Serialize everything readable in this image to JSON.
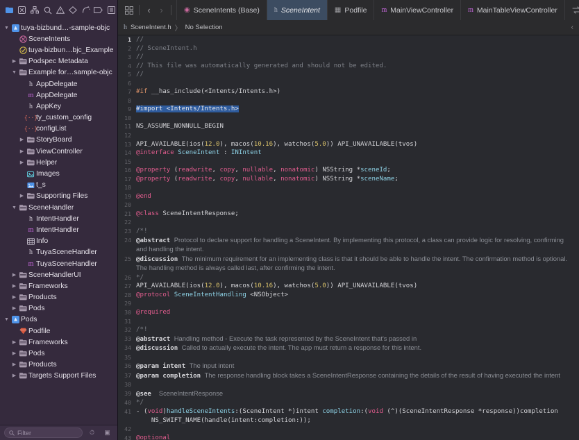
{
  "window": {
    "toolbar_icons": [
      "folder-icon",
      "issue-icon",
      "hierarchy-icon",
      "search-icon",
      "warning-icon",
      "diamond-icon",
      "debug-icon",
      "breakpoint-icon",
      "report-icon"
    ]
  },
  "navigator": {
    "filter_placeholder": "Filter",
    "items": [
      {
        "depth": 0,
        "twisty": "open",
        "icon": "proj",
        "label": "tuya-bizbund…-sample-objc"
      },
      {
        "depth": 1,
        "twisty": "",
        "icon": "scene",
        "label": "SceneIntents"
      },
      {
        "depth": 1,
        "twisty": "",
        "icon": "test",
        "label": "tuya-bizbun…bjc_Example"
      },
      {
        "depth": 1,
        "twisty": "closed",
        "icon": "folder",
        "label": "Podspec Metadata"
      },
      {
        "depth": 1,
        "twisty": "open",
        "icon": "folder",
        "label": "Example for…sample-objc"
      },
      {
        "depth": 2,
        "twisty": "",
        "icon": "h",
        "label": "AppDelegate"
      },
      {
        "depth": 2,
        "twisty": "",
        "icon": "m",
        "label": "AppDelegate"
      },
      {
        "depth": 2,
        "twisty": "",
        "icon": "h",
        "label": "AppKey"
      },
      {
        "depth": 2,
        "twisty": "",
        "icon": "plist",
        "label": "ty_custom_config"
      },
      {
        "depth": 2,
        "twisty": "",
        "icon": "plist",
        "label": "configList"
      },
      {
        "depth": 2,
        "twisty": "closed",
        "icon": "folder",
        "label": "StoryBoard"
      },
      {
        "depth": 2,
        "twisty": "closed",
        "icon": "folder",
        "label": "ViewController"
      },
      {
        "depth": 2,
        "twisty": "closed",
        "icon": "folder",
        "label": "Helper"
      },
      {
        "depth": 2,
        "twisty": "",
        "icon": "xcassets",
        "label": "Images"
      },
      {
        "depth": 2,
        "twisty": "",
        "icon": "img",
        "label": "t_s"
      },
      {
        "depth": 2,
        "twisty": "closed",
        "icon": "folder",
        "label": "Supporting Files"
      },
      {
        "depth": 1,
        "twisty": "open",
        "icon": "folder",
        "label": "SceneHandler"
      },
      {
        "depth": 2,
        "twisty": "",
        "icon": "h",
        "label": "IntentHandler"
      },
      {
        "depth": 2,
        "twisty": "",
        "icon": "m",
        "label": "IntentHandler"
      },
      {
        "depth": 2,
        "twisty": "",
        "icon": "table",
        "label": "Info"
      },
      {
        "depth": 2,
        "twisty": "",
        "icon": "h",
        "label": "TuyaSceneHandler"
      },
      {
        "depth": 2,
        "twisty": "",
        "icon": "m",
        "label": "TuyaSceneHandler"
      },
      {
        "depth": 1,
        "twisty": "closed",
        "icon": "folder",
        "label": "SceneHandlerUI"
      },
      {
        "depth": 1,
        "twisty": "closed",
        "icon": "folder",
        "label": "Frameworks"
      },
      {
        "depth": 1,
        "twisty": "closed",
        "icon": "folder",
        "label": "Products"
      },
      {
        "depth": 1,
        "twisty": "closed",
        "icon": "folder",
        "label": "Pods"
      },
      {
        "depth": 0,
        "twisty": "open",
        "icon": "proj",
        "label": "Pods"
      },
      {
        "depth": 1,
        "twisty": "",
        "icon": "podfile",
        "label": "Podfile"
      },
      {
        "depth": 1,
        "twisty": "closed",
        "icon": "folder",
        "label": "Frameworks"
      },
      {
        "depth": 1,
        "twisty": "closed",
        "icon": "folder",
        "label": "Pods"
      },
      {
        "depth": 1,
        "twisty": "closed",
        "icon": "folder",
        "label": "Products"
      },
      {
        "depth": 1,
        "twisty": "closed",
        "icon": "folder",
        "label": "Targets Support Files"
      }
    ]
  },
  "tabbar": {
    "back_arrow": "‹",
    "forward_arrow": "›",
    "tabs": [
      {
        "label": "SceneIntents (Base)",
        "icon": "sb",
        "selected": false
      },
      {
        "label": "SceneIntent",
        "icon": "h",
        "selected": true
      },
      {
        "label": "Podfile",
        "icon": "pod",
        "selected": false
      },
      {
        "label": "MainViewController",
        "icon": "m",
        "selected": false
      },
      {
        "label": "MainTableViewController",
        "icon": "m",
        "selected": false
      }
    ]
  },
  "breadcrumb": {
    "file": "SceneIntent.h",
    "separator": "〉",
    "selection": "No Selection",
    "collapse": "‹"
  },
  "editor": {
    "lines": [
      {
        "n": 1,
        "current": true
      },
      {
        "n": 2
      },
      {
        "n": 3
      },
      {
        "n": 4
      },
      {
        "n": 5
      },
      {
        "n": 6
      },
      {
        "n": 7
      },
      {
        "n": 8
      },
      {
        "n": 9
      },
      {
        "n": 10
      },
      {
        "n": 11
      },
      {
        "n": 12
      },
      {
        "n": 13
      },
      {
        "n": 14
      },
      {
        "n": 15
      },
      {
        "n": 16
      },
      {
        "n": 17
      },
      {
        "n": 18
      },
      {
        "n": 19
      },
      {
        "n": 20
      },
      {
        "n": 21
      },
      {
        "n": 22
      },
      {
        "n": 23
      },
      {
        "n": 24
      },
      {
        "n": 25
      },
      {
        "n": 26
      },
      {
        "n": 27
      },
      {
        "n": 28
      },
      {
        "n": 29
      },
      {
        "n": 30
      },
      {
        "n": 31
      },
      {
        "n": 32
      },
      {
        "n": 33
      },
      {
        "n": 34
      },
      {
        "n": 35
      },
      {
        "n": 36
      },
      {
        "n": 37
      },
      {
        "n": 38
      },
      {
        "n": 39
      },
      {
        "n": 40
      },
      {
        "n": 41
      },
      {
        "n": 42
      },
      {
        "n": 43
      }
    ],
    "text": {
      "l1": "//",
      "l2": "// SceneIntent.h",
      "l3": "//",
      "l4": "// This file was automatically generated and should not be edited.",
      "l5": "//",
      "l7": "#if __has_include(<Intents/Intents.h>)",
      "l9": "#import <Intents/Intents.h>",
      "l11": "NS_ASSUME_NONNULL_BEGIN",
      "l13": "API_AVAILABLE(ios(12.0), macos(10.16), watchos(5.0)) API_UNAVAILABLE(tvos)",
      "l14": "@interface SceneIntent : INIntent",
      "l16": "@property (readwrite, copy, nullable, nonatomic) NSString *sceneId;",
      "l17": "@property (readwrite, copy, nullable, nonatomic) NSString *sceneName;",
      "l19": "@end",
      "l21": "@class SceneIntentResponse;",
      "l23": "/*!",
      "l24_kw": "@abstract",
      "l24_txt": "Protocol to declare support for handling a SceneIntent. By implementing this protocol, a class can provide logic for resolving, confirming and handling the intent.",
      "l25_kw": "@discussion",
      "l25_txt": "The minimum requirement for an implementing class is that it should be able to handle the intent. The confirmation method is optional. The handling method is always called last, after confirming the intent.",
      "l26": "*/",
      "l27": "API_AVAILABLE(ios(12.0), macos(10.16), watchos(5.0)) API_UNAVAILABLE(tvos)",
      "l28": "@protocol SceneIntentHandling <NSObject>",
      "l30": "@required",
      "l32": "/*!",
      "l33_kw": "@abstract",
      "l33_txt": "Handling method - Execute the task represented by the SceneIntent that's passed in",
      "l34_kw": "@discussion",
      "l34_txt": "Called to actually execute the intent. The app must return a response for this intent.",
      "l36_kw": "@param",
      "l36_arg": "intent",
      "l36_txt": "The input intent",
      "l37_kw": "@param",
      "l37_arg": "completion",
      "l37_txt": "The response handling block takes a SceneIntentResponse containing the details of the result of having executed the intent",
      "l39_kw": "@see",
      "l39_txt": "SceneIntentResponse",
      "l40": "*/",
      "l41": "- (void)handleSceneIntents:(SceneIntent *)intent completion:(void (^)(SceneIntentResponse *response))completion",
      "l41b": "NS_SWIFT_NAME(handle(intent:completion:));",
      "l43": "@optional"
    }
  },
  "colors": {
    "sidebar_bg": "#352a3d",
    "editor_bg": "#292a2f",
    "tab_selected_bg": "#3c4c61",
    "selection": "#2f5c9e",
    "keyword": "#e35d8f",
    "type": "#8fd4e8",
    "number": "#d9c16a",
    "preprocessor": "#e0956a",
    "comment": "#7e8188"
  }
}
